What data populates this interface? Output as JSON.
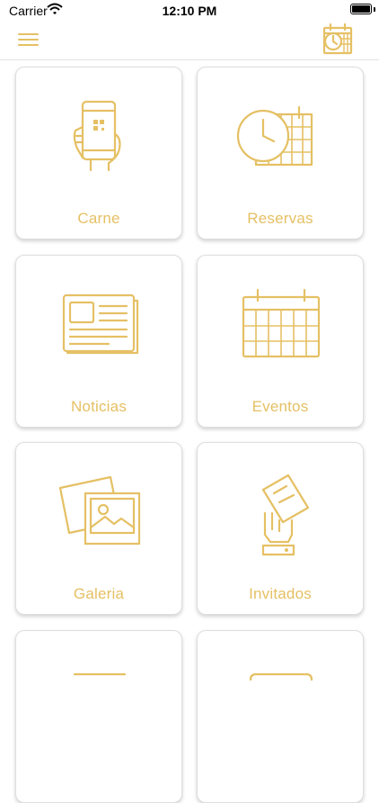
{
  "status": {
    "carrier": "Carrier",
    "time": "12:10 PM"
  },
  "nav": {
    "menu_icon": "hamburger-menu-icon",
    "action_icon": "calendar-clock-icon"
  },
  "theme": {
    "accent": "#e5c064",
    "divider": "#e2e2e2"
  },
  "menu": [
    {
      "label": "Carne",
      "icon": "phone-qr-icon"
    },
    {
      "label": "Reservas",
      "icon": "clock-calendar-icon"
    },
    {
      "label": "Noticias",
      "icon": "newspaper-icon"
    },
    {
      "label": "Eventos",
      "icon": "calendar-icon"
    },
    {
      "label": "Galeria",
      "icon": "photo-gallery-icon"
    },
    {
      "label": "Invitados",
      "icon": "hand-ticket-icon"
    },
    {
      "label": "",
      "icon": "partial-icon"
    },
    {
      "label": "",
      "icon": "partial-icon"
    }
  ]
}
